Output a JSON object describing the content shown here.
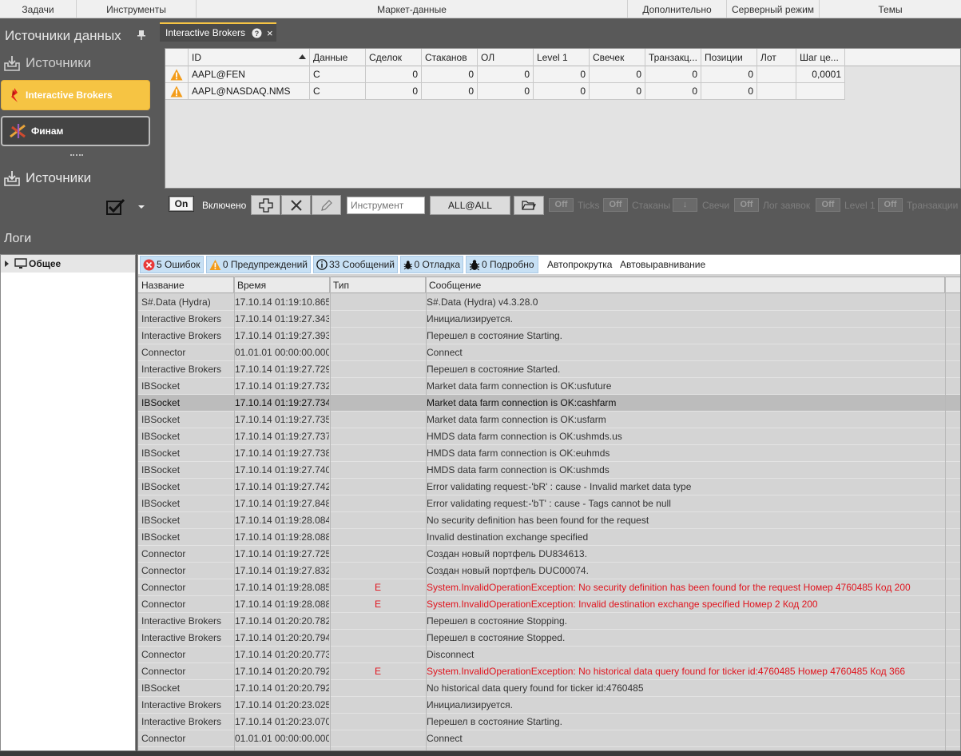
{
  "ribbon": [
    "Задачи",
    "Инструменты",
    "Маркет-данные",
    "Дополнительно",
    "Серверный режим",
    "Темы"
  ],
  "sources_panel": {
    "title": "Источники данных",
    "header_top": "Источники",
    "header_bottom": "Источники",
    "items": [
      {
        "label": "Interactive Brokers",
        "active": true
      },
      {
        "label": "Финам",
        "active": false
      }
    ]
  },
  "tab": {
    "label": "Interactive Brokers",
    "close": "×"
  },
  "securities_grid": {
    "columns": [
      "ID",
      "Данные",
      "Сделок",
      "Стаканов",
      "ОЛ",
      "Level 1",
      "Свечек",
      "Транзакц...",
      "Позиции",
      "Лот",
      "Шаг це..."
    ],
    "rows": [
      {
        "id": "AAPL@FEN",
        "data": "C",
        "trades": "0",
        "depths": "0",
        "ol": "0",
        "level1": "0",
        "candles": "0",
        "transactions": "0",
        "positions": "0",
        "lot": "",
        "step": "0,0001"
      },
      {
        "id": "AAPL@NASDAQ.NMS",
        "data": "C",
        "trades": "0",
        "depths": "0",
        "ol": "0",
        "level1": "0",
        "candles": "0",
        "transactions": "0",
        "positions": "0",
        "lot": "",
        "step": ""
      }
    ]
  },
  "toolbar": {
    "on_label": "On",
    "enabled_label": "Включено",
    "instrument_placeholder": "Инструмент",
    "all_label": "ALL@ALL",
    "toggles": [
      {
        "state": "Off",
        "label": "Ticks"
      },
      {
        "state": "Off",
        "label": "Стаканы"
      },
      {
        "state": "↓",
        "label": "Свечи"
      },
      {
        "state": "Off",
        "label": "Лог заявок"
      },
      {
        "state": "Off",
        "label": "Level 1"
      },
      {
        "state": "Off",
        "label": "Транзакции"
      }
    ]
  },
  "logs": {
    "title": "Логи",
    "tree_item": "Общее",
    "filters": {
      "errors": "5 Ошибок",
      "warnings": "0 Предупреждений",
      "messages": "33 Сообщений",
      "debug": "0 Отладка",
      "verbose": "0 Подробно",
      "autoscroll": "Автопрокрутка",
      "autoalign": "Автовыравнивание"
    },
    "columns": [
      "Название",
      "Время",
      "Тип",
      "Сообщение"
    ],
    "rows": [
      {
        "name": "S#.Data (Hydra)",
        "time": "17.10.14 01:19:10.865",
        "type": "",
        "message": "S#.Data (Hydra) v4.3.28.0"
      },
      {
        "name": "Interactive Brokers",
        "time": "17.10.14 01:19:27.343",
        "type": "",
        "message": "Инициализируется."
      },
      {
        "name": "Interactive Brokers",
        "time": "17.10.14 01:19:27.393",
        "type": "",
        "message": "Перешел в состояние Starting."
      },
      {
        "name": "Connector",
        "time": "01.01.01 00:00:00.000",
        "type": "",
        "message": "Connect"
      },
      {
        "name": "Interactive Brokers",
        "time": "17.10.14 01:19:27.729",
        "type": "",
        "message": "Перешел в состояние Started."
      },
      {
        "name": "IBSocket",
        "time": "17.10.14 01:19:27.732",
        "type": "",
        "message": "Market data farm connection is OK:usfuture"
      },
      {
        "name": "IBSocket",
        "time": "17.10.14 01:19:27.734",
        "type": "",
        "message": "Market data farm connection is OK:cashfarm",
        "selected": true
      },
      {
        "name": "IBSocket",
        "time": "17.10.14 01:19:27.735",
        "type": "",
        "message": "Market data farm connection is OK:usfarm"
      },
      {
        "name": "IBSocket",
        "time": "17.10.14 01:19:27.737",
        "type": "",
        "message": "HMDS data farm connection is OK:ushmds.us"
      },
      {
        "name": "IBSocket",
        "time": "17.10.14 01:19:27.738",
        "type": "",
        "message": "HMDS data farm connection is OK:euhmds"
      },
      {
        "name": "IBSocket",
        "time": "17.10.14 01:19:27.740",
        "type": "",
        "message": "HMDS data farm connection is OK:ushmds"
      },
      {
        "name": "IBSocket",
        "time": "17.10.14 01:19:27.742",
        "type": "",
        "message": "Error validating request:-'bR' : cause - Invalid market data type"
      },
      {
        "name": "IBSocket",
        "time": "17.10.14 01:19:27.848",
        "type": "",
        "message": "Error validating request:-'bT' : cause - Tags cannot be null"
      },
      {
        "name": "IBSocket",
        "time": "17.10.14 01:19:28.084",
        "type": "",
        "message": "No security definition has been found for the request"
      },
      {
        "name": "IBSocket",
        "time": "17.10.14 01:19:28.088",
        "type": "",
        "message": "Invalid destination exchange specified"
      },
      {
        "name": "Connector",
        "time": "17.10.14 01:19:27.725",
        "type": "",
        "message": "Создан новый портфель DU834613."
      },
      {
        "name": "Connector",
        "time": "17.10.14 01:19:27.832",
        "type": "",
        "message": "Создан новый портфель DUC00074."
      },
      {
        "name": "Connector",
        "time": "17.10.14 01:19:28.085",
        "type": "E",
        "message": "System.InvalidOperationException: No security definition has been found for the request Номер 4760485 Код 200",
        "error": true
      },
      {
        "name": "Connector",
        "time": "17.10.14 01:19:28.088",
        "type": "E",
        "message": "System.InvalidOperationException: Invalid destination exchange specified Номер 2 Код 200",
        "error": true
      },
      {
        "name": "Interactive Brokers",
        "time": "17.10.14 01:20:20.782",
        "type": "",
        "message": "Перешел в состояние Stopping."
      },
      {
        "name": "Interactive Brokers",
        "time": "17.10.14 01:20:20.794",
        "type": "",
        "message": "Перешел в состояние Stopped."
      },
      {
        "name": "Connector",
        "time": "17.10.14 01:20:20.773",
        "type": "",
        "message": "Disconnect"
      },
      {
        "name": "Connector",
        "time": "17.10.14 01:20:20.792",
        "type": "E",
        "message": "System.InvalidOperationException: No historical data query found for ticker id:4760485 Номер 4760485 Код 366",
        "error": true
      },
      {
        "name": "IBSocket",
        "time": "17.10.14 01:20:20.792",
        "type": "",
        "message": "No historical data query found for ticker id:4760485"
      },
      {
        "name": "Interactive Brokers",
        "time": "17.10.14 01:20:23.025",
        "type": "",
        "message": "Инициализируется."
      },
      {
        "name": "Interactive Brokers",
        "time": "17.10.14 01:20:23.070",
        "type": "",
        "message": "Перешел в состояние Starting."
      },
      {
        "name": "Connector",
        "time": "01.01.01 00:00:00.000",
        "type": "",
        "message": "Connect"
      }
    ]
  },
  "colors": {
    "accent": "#f6c443",
    "error_text": "#e0141e",
    "panel_bg": "#595959"
  }
}
